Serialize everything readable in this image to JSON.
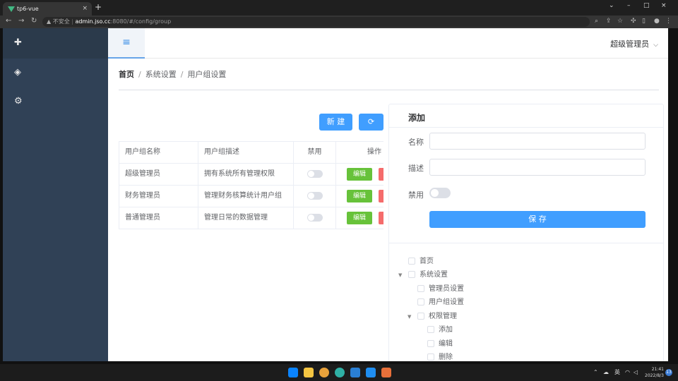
{
  "browser": {
    "tab_title": "tp6-vue",
    "tab_close": "×",
    "new_tab": "+",
    "security_warning": "▲ 不安全",
    "url_host": "admin.jso.cc",
    "url_rest": ":8080/#/config/group",
    "window_controls": [
      "⌄",
      "–",
      "□",
      "×"
    ]
  },
  "header": {
    "menu_toggle": "≡",
    "user_name": "超级管理员",
    "user_chevron": "⌵"
  },
  "sidebar": {
    "icons": [
      "logo-icon",
      "dashboard-icon",
      "settings-icon"
    ]
  },
  "breadcrumb": {
    "home": "首页",
    "sep": "/",
    "level2": "系统设置",
    "level3": "用户组设置"
  },
  "toolbar": {
    "new_label": "新 建",
    "refresh_label": "⟳"
  },
  "table": {
    "headers": [
      "用户组名称",
      "用户组描述",
      "禁用",
      "操作"
    ],
    "rows": [
      {
        "name": "超级管理员",
        "desc": "拥有系统所有管理权限",
        "disabled": false,
        "edit": "编辑"
      },
      {
        "name": "财务管理员",
        "desc": "管理财务核算统计用户组",
        "disabled": false,
        "edit": "编辑"
      },
      {
        "name": "普通管理员",
        "desc": "管理日常的数据管理",
        "disabled": false,
        "edit": "编辑"
      }
    ]
  },
  "form": {
    "title": "添加",
    "name_label": "名称",
    "name_value": "",
    "desc_label": "描述",
    "desc_value": "",
    "disabled_label": "禁用",
    "disabled_value": false,
    "save_label": "保 存"
  },
  "tree": {
    "nodes": [
      {
        "label": "首页",
        "level": 0,
        "expanded": null
      },
      {
        "label": "系统设置",
        "level": 0,
        "expanded": true
      },
      {
        "label": "管理员设置",
        "level": 1,
        "expanded": null
      },
      {
        "label": "用户组设置",
        "level": 1,
        "expanded": null
      },
      {
        "label": "权限管理",
        "level": 1,
        "expanded": true
      },
      {
        "label": "添加",
        "level": 2,
        "expanded": null
      },
      {
        "label": "编辑",
        "level": 2,
        "expanded": null
      },
      {
        "label": "删除",
        "level": 2,
        "expanded": null
      }
    ]
  },
  "taskbar": {
    "ime": "英",
    "time": "21:41",
    "date": "2022/8/3",
    "notifications": "13"
  }
}
